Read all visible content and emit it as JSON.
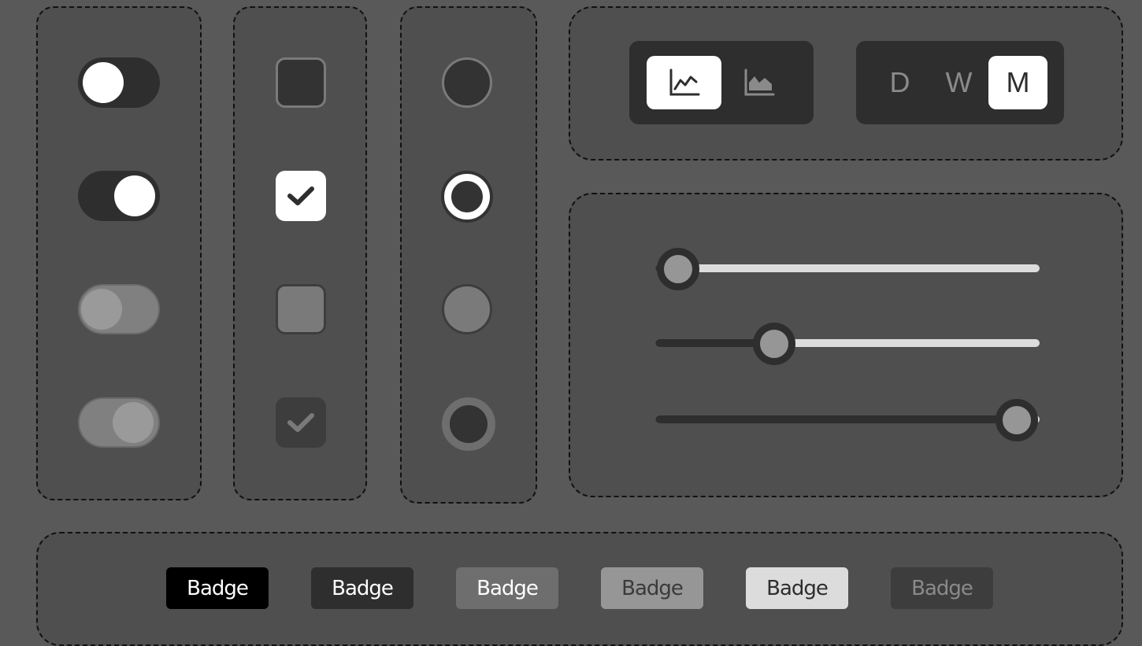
{
  "toggles": [
    {
      "state": "off",
      "disabled": false
    },
    {
      "state": "on",
      "disabled": false
    },
    {
      "state": "off",
      "disabled": true
    },
    {
      "state": "on",
      "disabled": true
    }
  ],
  "checkboxes": [
    {
      "checked": false,
      "disabled": false
    },
    {
      "checked": true,
      "disabled": false
    },
    {
      "checked": false,
      "disabled": true
    },
    {
      "checked": true,
      "disabled": true
    }
  ],
  "radios": [
    {
      "selected": false,
      "disabled": false
    },
    {
      "selected": true,
      "disabled": false
    },
    {
      "selected": false,
      "disabled": true
    },
    {
      "selected": true,
      "disabled": true
    }
  ],
  "chart_toggle": {
    "options": [
      {
        "icon": "line-chart-icon",
        "active": true
      },
      {
        "icon": "area-chart-icon",
        "active": false
      }
    ]
  },
  "period_toggle": {
    "options": [
      {
        "label": "D",
        "active": false
      },
      {
        "label": "W",
        "active": false
      },
      {
        "label": "M",
        "active": true
      }
    ]
  },
  "sliders": [
    {
      "value": 0.06
    },
    {
      "value": 0.31
    },
    {
      "value": 0.94
    }
  ],
  "badges": [
    {
      "label": "Badge",
      "bg": "#000000",
      "fg": "#ffffff"
    },
    {
      "label": "Badge",
      "bg": "#2e2e2e",
      "fg": "#ffffff"
    },
    {
      "label": "Badge",
      "bg": "#6e6e6e",
      "fg": "#ffffff"
    },
    {
      "label": "Badge",
      "bg": "#969696",
      "fg": "#3a3a3a"
    },
    {
      "label": "Badge",
      "bg": "#dcdcdc",
      "fg": "#2e2e2e"
    },
    {
      "label": "Badge",
      "bg": "#3d3d3d",
      "fg": "#8a8a8a"
    }
  ],
  "colors": {
    "page_bg": "#595959",
    "panel_bg": "#4f4f4f",
    "dark": "#2e2e2e",
    "white": "#ffffff"
  }
}
